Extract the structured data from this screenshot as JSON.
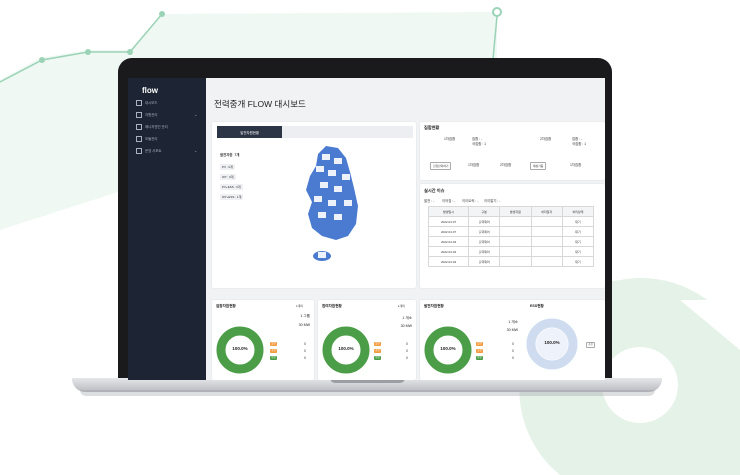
{
  "colors": {
    "accent_green": "#9bd3b6",
    "donut_green": "#4b9e47",
    "donut_blue": "#cfdcf0",
    "map_blue": "#4a7bd0",
    "sidebar": "#1d2433",
    "tag_orange": "#f39a3d"
  },
  "app": {
    "logo": "flow",
    "title": "전력중개 FLOW 대시보드"
  },
  "sidebar": {
    "items": [
      {
        "label": "대시보드",
        "icon": "grid-icon"
      },
      {
        "label": "자원관리",
        "icon": "list-icon",
        "chevron": "⌄"
      },
      {
        "label": "에너지엔진 관리",
        "icon": "engine-icon"
      },
      {
        "label": "모듈관리",
        "icon": "settings-icon"
      },
      {
        "label": "운영 서포트",
        "icon": "mail-icon",
        "chevron": "⌄"
      }
    ]
  },
  "map_panel": {
    "tabs": [
      "발전자원현황",
      "",
      ""
    ],
    "count_label": "발전자원",
    "count_value": "7개",
    "legend": [
      "PV : 0개",
      "WT : 0개",
      "PV+ESS : 0개",
      "WT+ESS : 1개"
    ]
  },
  "status_panel": {
    "title": "집합현황",
    "col1_head": "1차집합",
    "col2_head": "2차집합",
    "col1_lines": [
      "집합 : -",
      "국집합 : 1"
    ],
    "col2_lines": [
      "집합 : -",
      "국집합 : 1"
    ],
    "buttons": [
      "집합관리하기",
      "예상가동"
    ],
    "mid_labels": [
      "1차집합",
      "2차집합",
      "1차집합"
    ]
  },
  "issues_panel": {
    "title": "실시간 이슈",
    "filters": [
      "발전 : -",
      "이어짐 : -",
      "이이트릭 : -",
      "이이알기 : -"
    ],
    "columns": [
      "발생일시",
      "구분",
      "발생자원",
      "처리일자",
      "처리상태"
    ],
    "rows": [
      [
        "2022.04.07",
        "출력제어",
        "",
        "",
        "대기"
      ],
      [
        "2022.04.07",
        "출력제어",
        "",
        "",
        "대기"
      ],
      [
        "2022.04.03",
        "출력제어",
        "",
        "",
        "대기"
      ],
      [
        "2022.04.03",
        "출력제어",
        "",
        "",
        "대기"
      ],
      [
        "2022.04.03",
        "출력제어",
        "",
        "",
        "대기"
      ]
    ]
  },
  "bottom_cards": [
    {
      "title": "집합자원현황",
      "sub": "1개의",
      "line1": "1 그룹",
      "line2": "30 MW",
      "pct": "100.0%",
      "tags": [
        "발전",
        "충전",
        "방전"
      ],
      "values": [
        "0",
        "0",
        "0"
      ]
    },
    {
      "title": "참여자원현황",
      "sub": "1개의",
      "line1": "1 개소",
      "line2": "30 MW",
      "pct": "100.0%",
      "tags": [
        "발전",
        "충전",
        "방전"
      ],
      "values": [
        "0",
        "0",
        "0"
      ]
    },
    {
      "title": "발전자원현황",
      "sub": "",
      "line1": "1 개소",
      "line2": "30 MW",
      "pct": "100.0%",
      "tags": [
        "발전",
        "충전",
        "방전"
      ],
      "values": [
        "0",
        "0",
        "0"
      ]
    },
    {
      "title": "ESS현황",
      "sub": "",
      "line1": "",
      "line2": "",
      "pct": "100.0%",
      "tags": [
        "충전"
      ],
      "values": [
        ""
      ]
    }
  ]
}
